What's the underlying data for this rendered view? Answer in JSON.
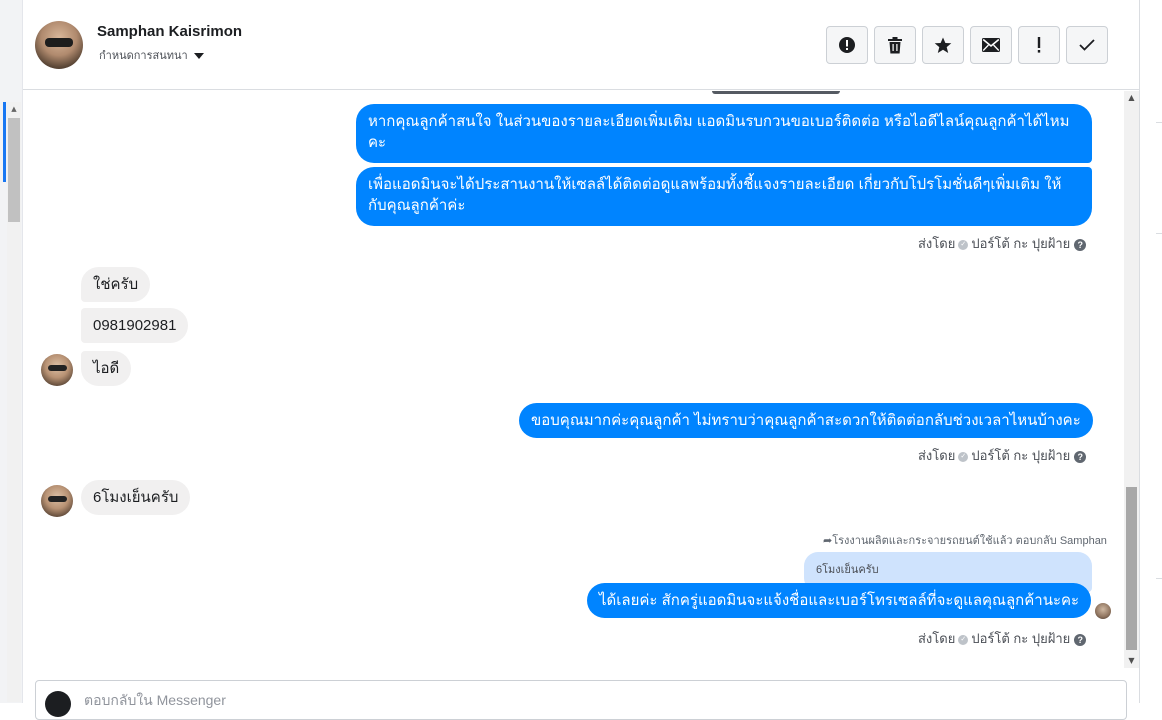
{
  "header": {
    "name": "Samphan Kaisrimon",
    "subtitle": "กำหนดการสนทนา",
    "actions": [
      "alert-circle",
      "trash",
      "star",
      "envelope",
      "exclamation",
      "check"
    ]
  },
  "messages": {
    "out1_a": "หากคุณลูกค้าสนใจ ในส่วนของรายละเอียดเพิ่มเติม แอดมินรบกวนขอเบอร์ติดต่อ หรือไอดีไลน์คุณลูกค้าได้ไหม คะ",
    "out1_b": "เพื่อแอดมินจะได้ประสานงานให้เซลล์ได้ติดต่อดูแลพร้อมทั้งชี้แจงรายละเอียด เกี่ยวกับโปรโมชั่นดีๆเพิ่มเติม ให้ กับคุณลูกค้าค่ะ",
    "in1_a": "ใช่ครับ",
    "in1_b": "0981902981",
    "in1_c": "ไอดี",
    "out2": "ขอบคุณมากค่ะคุณลูกค้า ไม่ทราบว่าคุณลูกค้าสะดวกให้ติดต่อกลับช่วงเวลาไหนบ้างคะ",
    "in2": "6โมงเย็นครับ",
    "reply_note": "โรงงานผลิตและกระจายรถยนต์ใช้แล้ว ตอบกลับ Samphan",
    "quoted": "6โมงเย็นครับ",
    "out3": "ได้เลยค่ะ สักครู่แอดมินจะแจ้งชื่อและเบอร์โทรเซลล์ที่จะดูแลคุณลูกค้านะคะ"
  },
  "sent_by": {
    "prefix": "ส่งโดย",
    "author": "ปอร์โต้ กะ ปุยฝ้าย",
    "help": "?"
  },
  "composer": {
    "placeholder": "ตอบกลับใน Messenger"
  },
  "colors": {
    "outgoing_bubble": "#0084ff",
    "incoming_bubble": "#f1f0f0",
    "quoted_bubble": "#cfe3fd",
    "accent": "#1877f2"
  }
}
